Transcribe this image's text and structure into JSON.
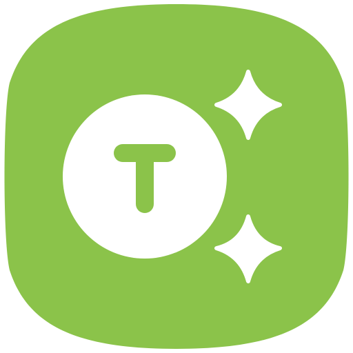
{
  "icon": {
    "name": "text-effects-app-icon",
    "letter": "T",
    "colors": {
      "background": "#ffffff",
      "tile": "#8bc34a",
      "glyph": "#ffffff"
    },
    "decorations": [
      "circle-with-letter",
      "sparkle-star-top",
      "sparkle-star-bottom"
    ]
  }
}
